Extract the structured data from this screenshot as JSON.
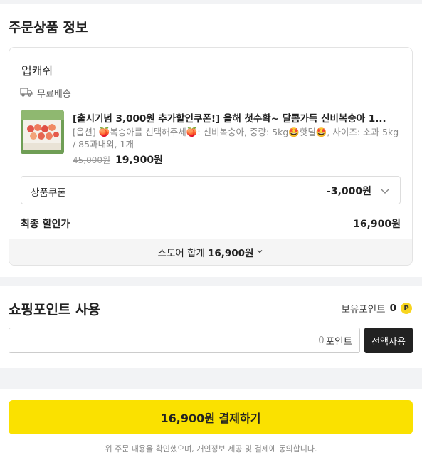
{
  "order_section": {
    "title": "주문상품 정보"
  },
  "store": {
    "name": "업캐쉬",
    "shipping_label": "무료배송",
    "product": {
      "title": "[출시기념 3,000원 추가할인쿠폰!] 올해 첫수확~ 달콤가득 신비복숭아 1...",
      "option_text": "[옵션] 🍑복숭아를 선택해주세🍑: 신비복숭아, 중량: 5kg🤩핫딜🤩, 사이즈: 소과 5kg / 85과내외, 1개",
      "original_price": "45,000원",
      "sale_price": "19,900원"
    },
    "coupon": {
      "label": "상품쿠폰",
      "value": "-3,000원"
    },
    "final": {
      "label": "최종 할인가",
      "value": "16,900원"
    },
    "total": {
      "label": "스토어 합계",
      "value": "16,900원"
    }
  },
  "points": {
    "title": "쇼핑포인트 사용",
    "have_label": "보유포인트",
    "have_value": "0",
    "badge": "P",
    "input_value": "0",
    "input_unit": "포인트",
    "use_all_label": "전액사용"
  },
  "payment": {
    "button_label": "16,900원 결제하기",
    "agreement": "위 주문 내용을 확인했으며, 개인정보 제공 및 결제에 동의합니다."
  },
  "colors": {
    "pay_button": "#fae100",
    "point_badge": "#f8d51f",
    "dark_button": "#222222"
  },
  "icons": {
    "shipping": "truck-icon",
    "coupon_toggle": "chevron-down-icon",
    "total_toggle": "chevron-down-icon"
  }
}
